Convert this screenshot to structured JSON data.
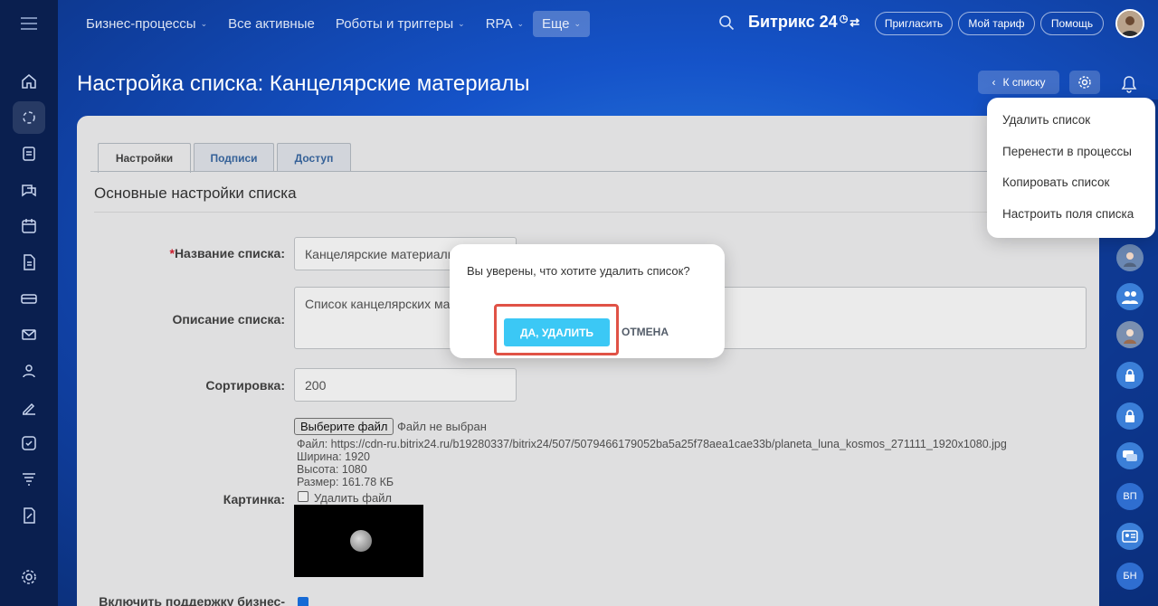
{
  "topbar": {
    "nav": [
      {
        "label": "Бизнес-процессы",
        "has_chevron": true
      },
      {
        "label": "Все активные",
        "has_chevron": false
      },
      {
        "label": "Роботы и триггеры",
        "has_chevron": true
      },
      {
        "label": "RPA",
        "has_chevron": true
      },
      {
        "label": "Еще",
        "has_chevron": true
      }
    ],
    "logo": "Битрикс 24",
    "invite": "Пригласить",
    "tariff": "Мой тариф",
    "help": "Помощь"
  },
  "page": {
    "title": "Настройка списка: Канцелярские материалы",
    "back": "К списку"
  },
  "tabs": [
    "Настройки",
    "Подписи",
    "Доступ"
  ],
  "section": "Основные настройки списка",
  "form": {
    "name_label": "Название списка:",
    "name_value": "Канцелярские материалы",
    "desc_label": "Описание списка:",
    "desc_value": "Список канцелярских материалов",
    "sort_label": "Сортировка:",
    "sort_value": "200",
    "pic_label": "Картинка:",
    "file_button": "Выберите файл",
    "file_none": "Файл не выбран",
    "file_path": "Файл: https://cdn-ru.bitrix24.ru/b19280337/bitrix24/507/5079466179052ba5a25f78aea1cae33b/planeta_luna_kosmos_271111_1920x1080.jpg",
    "width": "Ширина: 1920",
    "height": "Высота: 1080",
    "size": "Размер: 161.78 КБ",
    "delete_file": "Удалить файл",
    "bp_label": "Включить поддержку бизнес-"
  },
  "dialog": {
    "text": "Вы уверены, что хотите удалить список?",
    "confirm": "ДА, УДАЛИТЬ",
    "cancel": "ОТМЕНА"
  },
  "menu": [
    "Удалить список",
    "Перенести в процессы",
    "Копировать список",
    "Настроить поля списка"
  ],
  "rightbar_badges": [
    "ВП",
    "БН"
  ]
}
